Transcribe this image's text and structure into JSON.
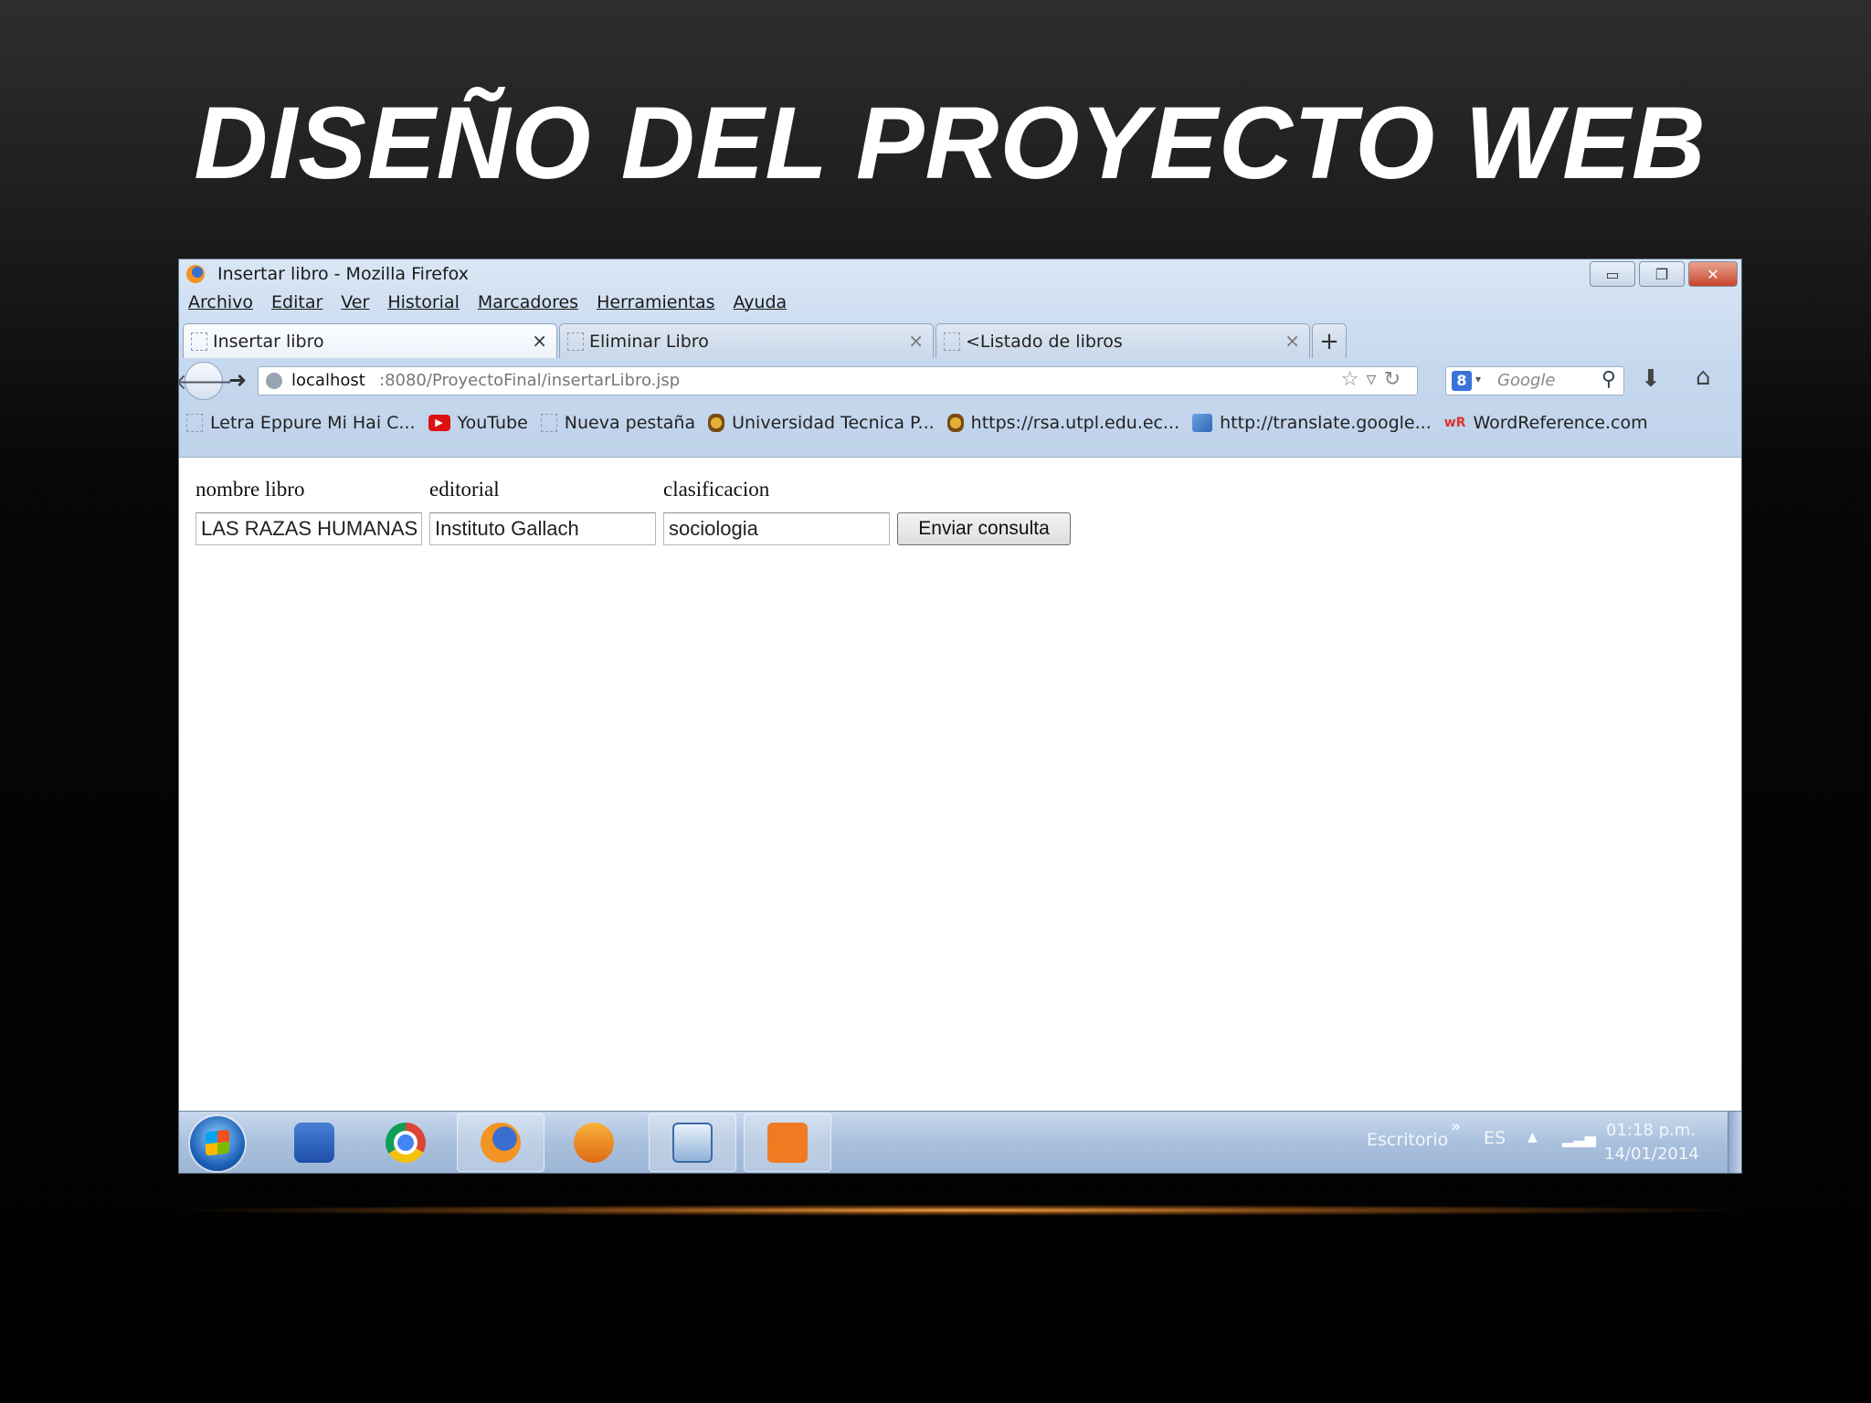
{
  "slide": {
    "title": "DISEÑO DEL PROYECTO WEB"
  },
  "window": {
    "title": "Insertar libro - Mozilla Firefox",
    "controls": {
      "minimize": "▭",
      "restore": "❐",
      "close": "✕"
    }
  },
  "menu": [
    "Archivo",
    "Editar",
    "Ver",
    "Historial",
    "Marcadores",
    "Herramientas",
    "Ayuda"
  ],
  "tabs": [
    {
      "label": "Insertar libro",
      "close": "×",
      "active": true
    },
    {
      "label": "Eliminar Libro",
      "close": "×",
      "active": false
    },
    {
      "label": "<Listado de libros",
      "close": "×",
      "active": false
    }
  ],
  "new_tab": "+",
  "nav": {
    "url_host": "localhost",
    "url_path": ":8080/ProyectoFinal/insertarLibro.jsp",
    "search_placeholder": "Google",
    "search_engine_letter": "8"
  },
  "bookmarks": [
    {
      "label": "Letra Eppure Mi Hai C...",
      "icon": "page-icon"
    },
    {
      "label": "YouTube",
      "icon": "youtube-icon"
    },
    {
      "label": "Nueva pestaña",
      "icon": "page-icon"
    },
    {
      "label": "Universidad Tecnica P...",
      "icon": "seal-icon"
    },
    {
      "label": "https://rsa.utpl.edu.ec...",
      "icon": "seal-icon"
    },
    {
      "label": "http://translate.google...",
      "icon": "translate-icon"
    },
    {
      "label": "WordReference.com",
      "icon": "wordreference-icon"
    }
  ],
  "form": {
    "labels": {
      "nombre": "nombre libro",
      "editorial": "editorial",
      "clasificacion": "clasificacion"
    },
    "values": {
      "nombre": "LAS RAZAS HUMANAS",
      "editorial": "Instituto Gallach",
      "clasificacion": "sociologia"
    },
    "submit": "Enviar consulta"
  },
  "taskbar": {
    "apps": [
      "messenger-icon",
      "chrome-icon",
      "firefox-icon",
      "media-player-icon",
      "virtualbox-icon",
      "xampp-icon"
    ],
    "desktop_label": "Escritorio",
    "language": "ES",
    "time": "01:18 p.m.",
    "date": "14/01/2014"
  }
}
